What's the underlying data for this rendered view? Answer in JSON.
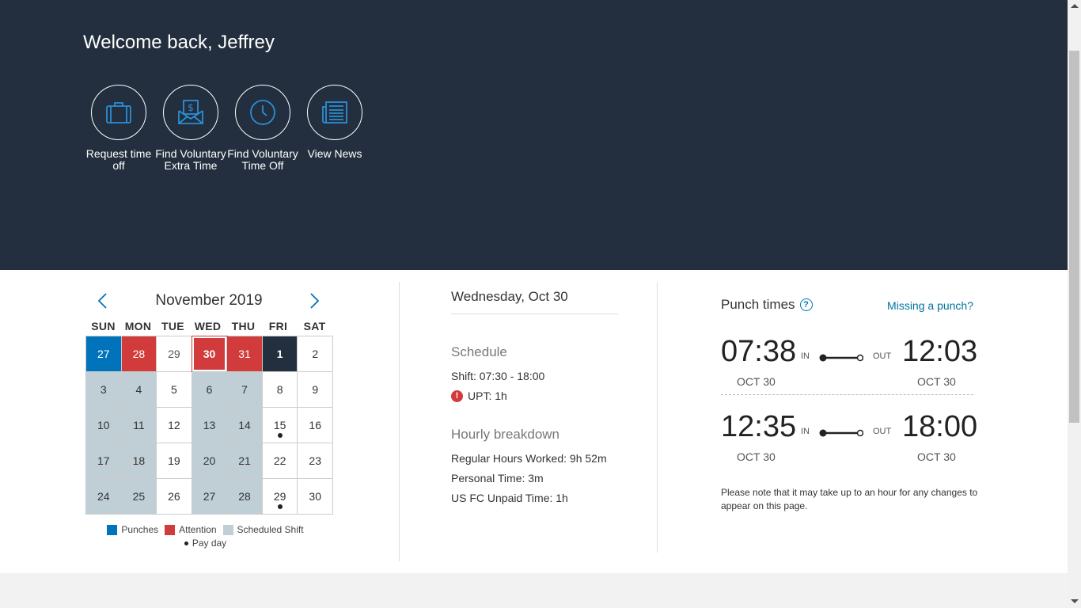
{
  "header": {
    "welcome": "Welcome back, Jeffrey",
    "actions": [
      {
        "label": "Request time off",
        "icon": "briefcase-icon"
      },
      {
        "label": "Find Voluntary Extra Time",
        "icon": "money-envelope-icon"
      },
      {
        "label": "Find Voluntary Time Off",
        "icon": "clock-icon"
      },
      {
        "label": "View News",
        "icon": "newspaper-icon"
      }
    ]
  },
  "calendar": {
    "title": "November 2019",
    "weekdays": [
      "SUN",
      "MON",
      "TUE",
      "WED",
      "THU",
      "FRI",
      "SAT"
    ],
    "days": [
      {
        "n": "27",
        "s": "punch"
      },
      {
        "n": "28",
        "s": "attn"
      },
      {
        "n": "29",
        "s": "muted"
      },
      {
        "n": "30",
        "s": "selected"
      },
      {
        "n": "31",
        "s": "attn"
      },
      {
        "n": "1",
        "s": "today"
      },
      {
        "n": "2",
        "s": ""
      },
      {
        "n": "3",
        "s": "sched"
      },
      {
        "n": "4",
        "s": "sched"
      },
      {
        "n": "5",
        "s": ""
      },
      {
        "n": "6",
        "s": "sched"
      },
      {
        "n": "7",
        "s": "sched"
      },
      {
        "n": "8",
        "s": ""
      },
      {
        "n": "9",
        "s": ""
      },
      {
        "n": "10",
        "s": "sched"
      },
      {
        "n": "11",
        "s": "sched"
      },
      {
        "n": "12",
        "s": ""
      },
      {
        "n": "13",
        "s": "sched"
      },
      {
        "n": "14",
        "s": "sched"
      },
      {
        "n": "15",
        "s": "",
        "pay": true
      },
      {
        "n": "16",
        "s": ""
      },
      {
        "n": "17",
        "s": "sched"
      },
      {
        "n": "18",
        "s": "sched"
      },
      {
        "n": "19",
        "s": ""
      },
      {
        "n": "20",
        "s": "sched"
      },
      {
        "n": "21",
        "s": "sched"
      },
      {
        "n": "22",
        "s": ""
      },
      {
        "n": "23",
        "s": ""
      },
      {
        "n": "24",
        "s": "sched"
      },
      {
        "n": "25",
        "s": "sched"
      },
      {
        "n": "26",
        "s": ""
      },
      {
        "n": "27",
        "s": "sched"
      },
      {
        "n": "28",
        "s": "sched"
      },
      {
        "n": "29",
        "s": "",
        "pay": true
      },
      {
        "n": "30",
        "s": ""
      }
    ],
    "legend": {
      "punches": "Punches",
      "attention": "Attention",
      "scheduled": "Scheduled Shift",
      "payday": "Pay day"
    },
    "colors": {
      "punches": "#0073bb",
      "attention": "#d13b3b",
      "scheduled": "#bfcfd5",
      "today": "#232f3e"
    }
  },
  "details": {
    "date": "Wednesday, Oct 30",
    "schedule_title": "Schedule",
    "shift": "Shift: 07:30 - 18:00",
    "upt": "UPT: 1h",
    "upt_icon": "!",
    "hourly_title": "Hourly breakdown",
    "regular": "Regular Hours Worked: 9h 52m",
    "personal": "Personal Time: 3m",
    "unpaid": "US FC Unpaid Time: 1h"
  },
  "punches": {
    "title": "Punch times",
    "help": "?",
    "missing": "Missing a punch?",
    "in_label": "IN",
    "out_label": "OUT",
    "rows": [
      {
        "in": "07:38",
        "in_date": "OCT 30",
        "out": "12:03",
        "out_date": "OCT 30"
      },
      {
        "in": "12:35",
        "in_date": "OCT 30",
        "out": "18:00",
        "out_date": "OCT 30"
      }
    ],
    "note": "Please note that it may take up to an hour for any changes to appear on this page."
  }
}
